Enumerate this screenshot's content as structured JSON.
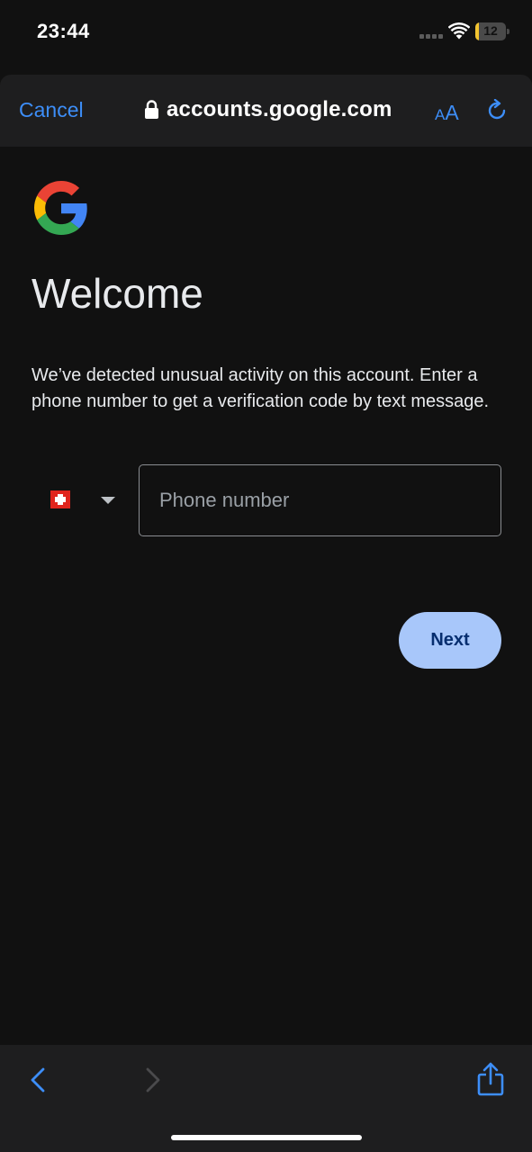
{
  "status_bar": {
    "time": "23:44",
    "battery_level": "12"
  },
  "browser": {
    "cancel_label": "Cancel",
    "url": "accounts.google.com",
    "text_size_small": "A",
    "text_size_big": "A"
  },
  "page": {
    "heading": "Welcome",
    "description": "We’ve detected unusual activity on this account. Enter a phone number to get a verification code by text message.",
    "phone_placeholder": "Phone number",
    "next_label": "Next"
  },
  "colors": {
    "accent": "#3d8ef8",
    "next_button_bg": "#a8c7fa",
    "next_button_text": "#062e6f",
    "background": "#111111",
    "toolbar": "#1e1e1f",
    "battery_fill": "#f2c430",
    "flag_red": "#e0241c"
  },
  "icons": {
    "lock": "lock-icon",
    "reload": "reload-icon",
    "google_logo": "google-logo",
    "country_flag": "switzerland-flag-icon",
    "dropdown": "caret-down-icon",
    "back": "chevron-left-icon",
    "forward": "chevron-right-icon",
    "share": "share-icon",
    "wifi": "wifi-icon",
    "signal": "signal-icon",
    "battery": "battery-icon"
  },
  "battery_fraction": 0.12
}
